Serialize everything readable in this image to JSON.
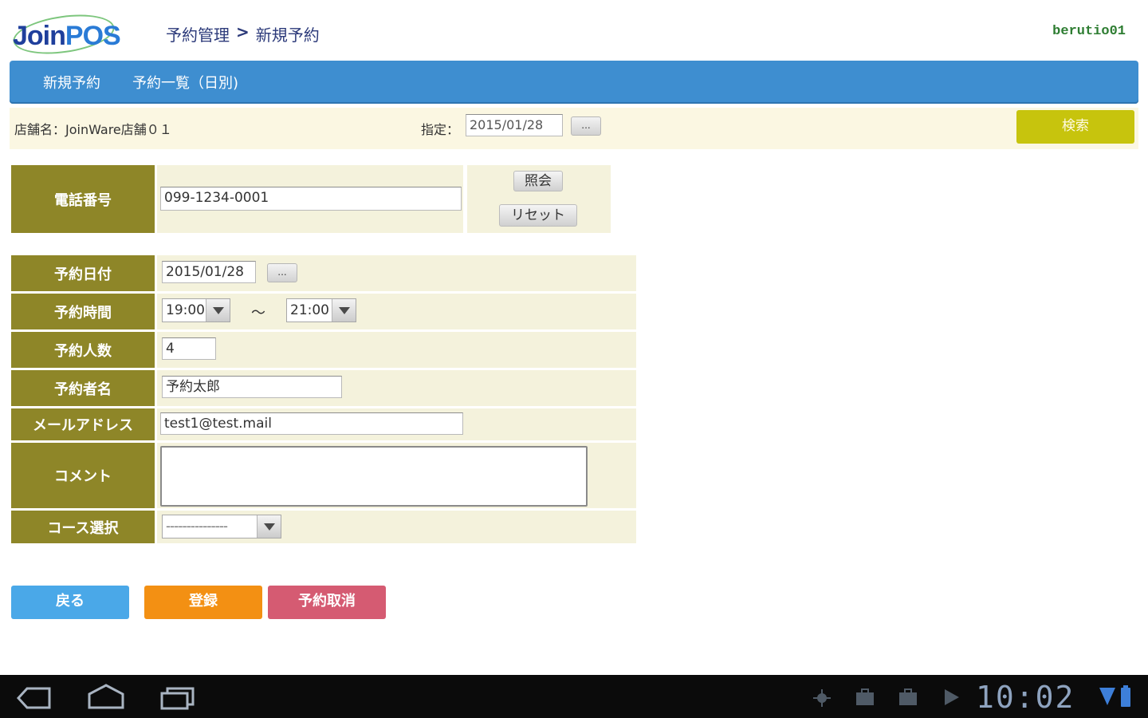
{
  "header": {
    "logo_join": "Join",
    "logo_pos": "POS",
    "breadcrumb_parent": "予約管理",
    "breadcrumb_sep": ">",
    "breadcrumb_current": "新規予約",
    "username": "berutio01"
  },
  "nav": {
    "items": [
      {
        "label": "新規予約"
      },
      {
        "label": "予約一覧（日別)"
      }
    ]
  },
  "infobar": {
    "store_label": "店舗名：JoinWare店舗０１",
    "date_label": "指定：",
    "date_value": "2015/01/28",
    "date_picker_label": "...",
    "search_label": "検索"
  },
  "phone": {
    "label": "電話番号",
    "value": "099-1234-0001",
    "inquiry_label": "照会",
    "reset_label": "リセット"
  },
  "form": {
    "date": {
      "label": "予約日付",
      "value": "2015/01/28",
      "picker_label": "..."
    },
    "time": {
      "label": "予約時間",
      "start": "19:00",
      "separator": "～",
      "end": "21:00"
    },
    "people": {
      "label": "予約人数",
      "value": "4"
    },
    "name": {
      "label": "予約者名",
      "value": "予約太郎"
    },
    "email": {
      "label": "メールアドレス",
      "value": "test1@test.mail"
    },
    "comment": {
      "label": "コメント",
      "value": ""
    },
    "course": {
      "label": "コース選択",
      "value": "---------------"
    }
  },
  "actions": {
    "back": "戻る",
    "register": "登録",
    "cancel": "予約取消"
  },
  "system_bar": {
    "clock": "10:02"
  },
  "colors": {
    "nav_bg": "#3e8ed0",
    "label_bg": "#8e8628",
    "cell_bg": "#f4f2dc",
    "search_btn": "#c7c40d",
    "back_btn": "#4aa8e8",
    "register_btn": "#f39013",
    "cancel_btn": "#d55b72",
    "username": "#2e7d32"
  }
}
